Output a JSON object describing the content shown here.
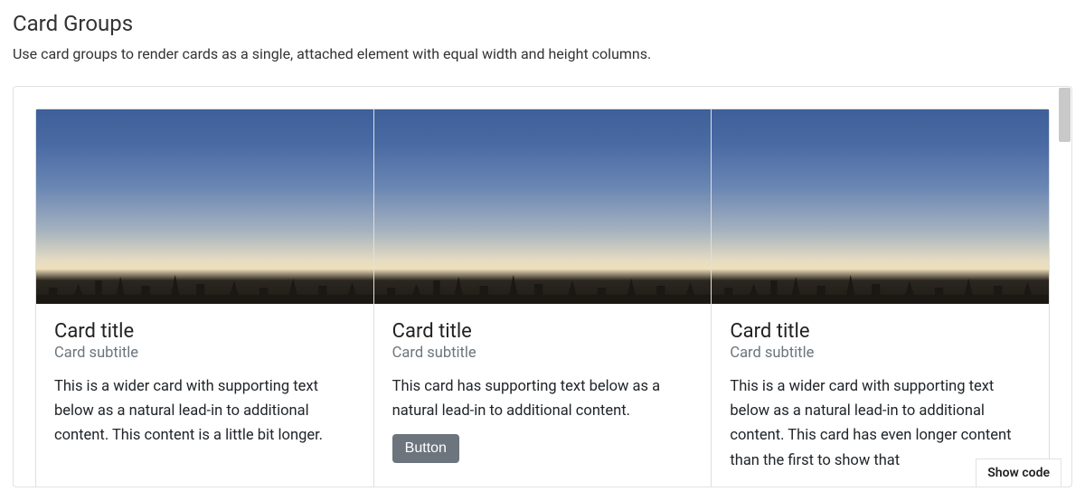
{
  "section": {
    "heading": "Card Groups",
    "description": "Use card groups to render cards as a single, attached element with equal width and height columns."
  },
  "cards": [
    {
      "title": "Card title",
      "subtitle": "Card subtitle",
      "text": "This is a wider card with supporting text below as a natural lead-in to additional content. This content is a little bit longer.",
      "has_button": false,
      "button_label": ""
    },
    {
      "title": "Card title",
      "subtitle": "Card subtitle",
      "text": "This card has supporting text below as a natural lead-in to additional content.",
      "has_button": true,
      "button_label": "Button"
    },
    {
      "title": "Card title",
      "subtitle": "Card subtitle",
      "text": "This is a wider card with supporting text below as a natural lead-in to additional content. This card has even longer content than the first to show that",
      "has_button": false,
      "button_label": ""
    }
  ],
  "actions": {
    "show_code": "Show code"
  },
  "image": {
    "alt": "city-skyline-dusk"
  }
}
